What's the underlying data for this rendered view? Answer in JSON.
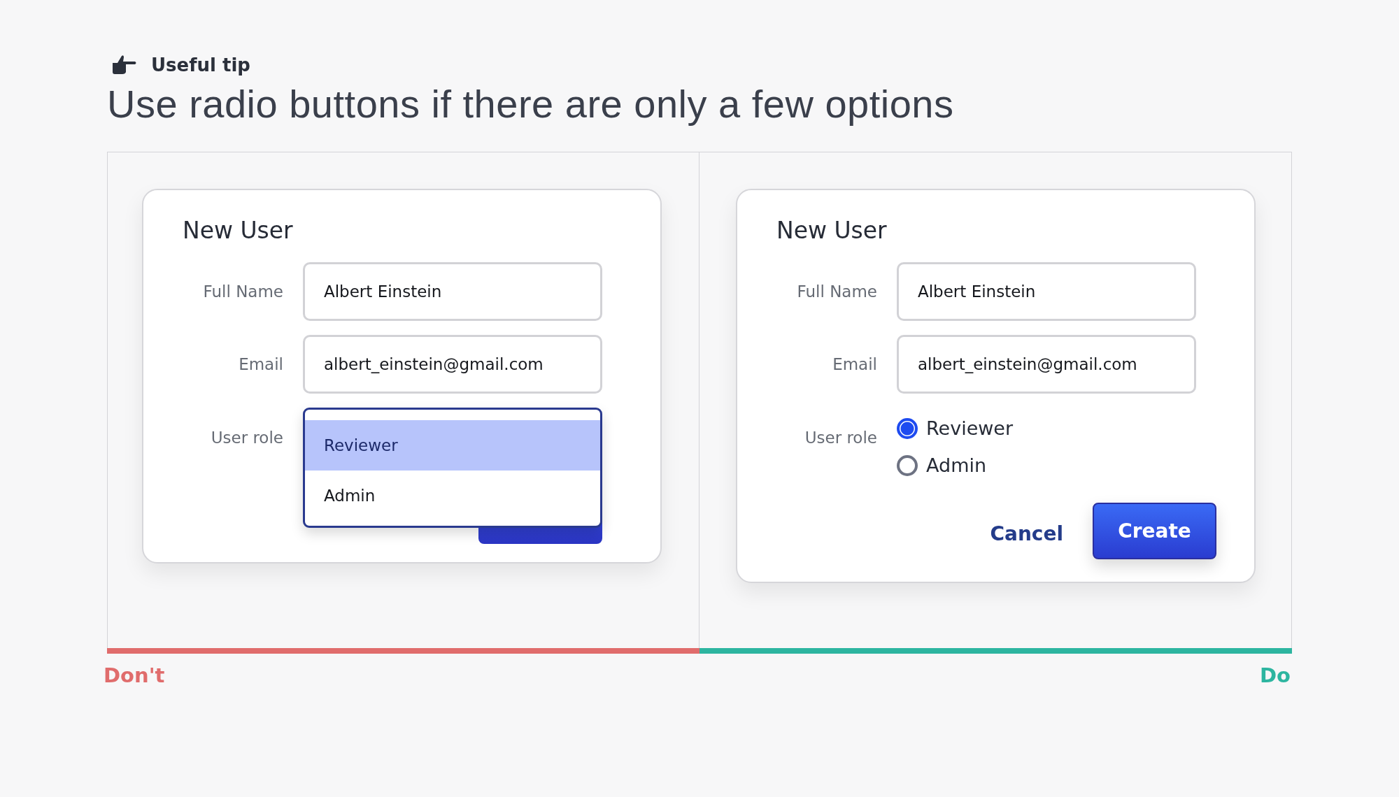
{
  "tip": {
    "label": "Useful tip"
  },
  "headline": "Use radio buttons if there are only a few options",
  "examples": [
    {
      "kind": "dropdown",
      "verdict": "Don't",
      "color": "#e06c6c",
      "dialog": {
        "title": "New User",
        "fields": [
          {
            "label": "Full Name",
            "value": "Albert Einstein"
          },
          {
            "label": "Email",
            "value": "albert_einstein@gmail.com"
          }
        ],
        "role_label": "User role",
        "options": [
          {
            "label": "Reviewer",
            "selected": true
          },
          {
            "label": "Admin",
            "selected": false
          }
        ]
      }
    },
    {
      "kind": "radio",
      "verdict": "Do",
      "color": "#2db5a0",
      "dialog": {
        "title": "New User",
        "fields": [
          {
            "label": "Full Name",
            "value": "Albert Einstein"
          },
          {
            "label": "Email",
            "value": "albert_einstein@gmail.com"
          }
        ],
        "role_label": "User role",
        "options": [
          {
            "label": "Reviewer",
            "selected": true
          },
          {
            "label": "Admin",
            "selected": false
          }
        ],
        "buttons": [
          {
            "label": "Cancel",
            "kind": "link"
          },
          {
            "label": "Create",
            "kind": "primary"
          }
        ]
      }
    }
  ]
}
